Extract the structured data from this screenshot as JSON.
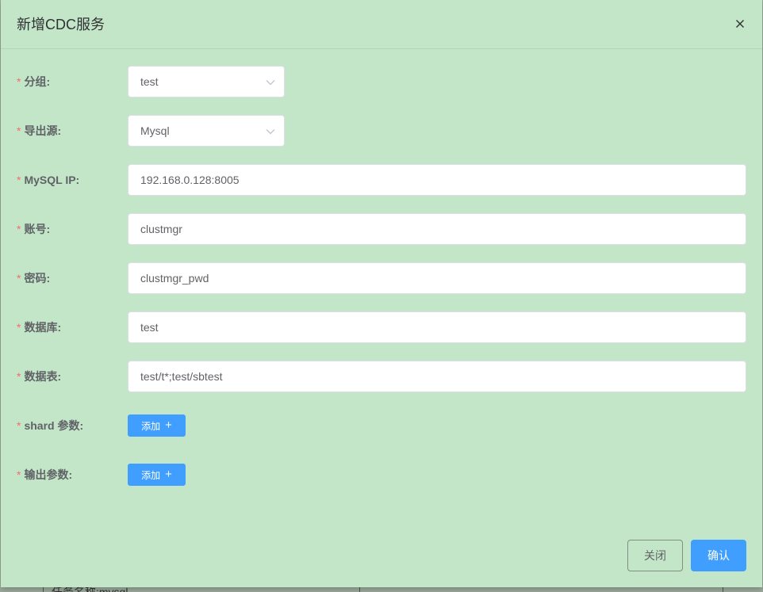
{
  "dialog": {
    "title": "新增CDC服务",
    "close_icon": "close-icon"
  },
  "form": {
    "required_mark": "*",
    "group": {
      "label": "分组:",
      "value": "test"
    },
    "source": {
      "label": "导出源:",
      "value": "Mysql"
    },
    "mysql_ip": {
      "label": "MySQL IP:",
      "value": "192.168.0.128:8005"
    },
    "account": {
      "label": "账号:",
      "value": "clustmgr"
    },
    "password": {
      "label": "密码:",
      "value": "clustmgr_pwd"
    },
    "database": {
      "label": "数据库:",
      "value": "test"
    },
    "table": {
      "label": "数据表:",
      "value": "test/t*;test/sbtest"
    },
    "shard_params": {
      "label": "shard 参数:",
      "button": "添加",
      "icon": "plus-icon"
    },
    "output_params": {
      "label": "输出参数:",
      "button": "添加",
      "icon": "plus-icon"
    }
  },
  "footer": {
    "cancel_label": "关闭",
    "confirm_label": "确认"
  },
  "backdrop": {
    "row_text": "任务名称:mysql"
  },
  "colors": {
    "dialog_bg": "#c3e6c9",
    "primary": "#409eff",
    "required": "#f56c6c",
    "label": "#606266"
  }
}
